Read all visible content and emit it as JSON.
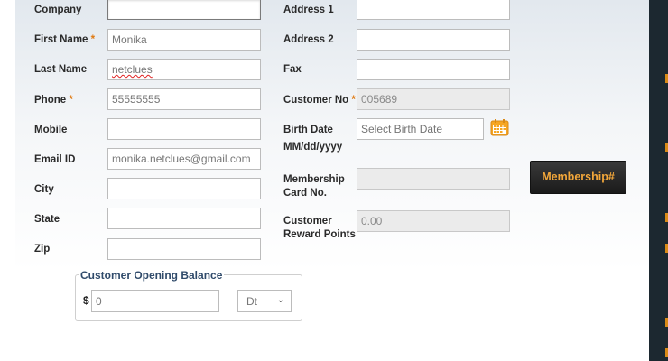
{
  "required_marker": "*",
  "left_fields": {
    "company": {
      "label": "Company",
      "value": ""
    },
    "first_name": {
      "label": "First Name",
      "value": "Monika"
    },
    "last_name": {
      "label": "Last Name",
      "value": "netclues"
    },
    "phone": {
      "label": "Phone",
      "value": "55555555"
    },
    "mobile": {
      "label": "Mobile",
      "value": ""
    },
    "email": {
      "label": "Email ID",
      "value": "monika.netclues@gmail.com"
    },
    "city": {
      "label": "City",
      "value": ""
    },
    "state": {
      "label": "State",
      "value": ""
    },
    "zip": {
      "label": "Zip",
      "value": ""
    }
  },
  "right_fields": {
    "address1": {
      "label": "Address 1",
      "value": ""
    },
    "address2": {
      "label": "Address 2",
      "value": ""
    },
    "fax": {
      "label": "Fax",
      "value": ""
    },
    "customer_no": {
      "label": "Customer No",
      "value": "005689"
    },
    "birth_date": {
      "label": "Birth Date",
      "sublabel": "MM/dd/yyyy",
      "placeholder": "Select Birth Date"
    },
    "membership_card": {
      "label_line1": "Membership",
      "label_line2": "Card No.",
      "value": ""
    },
    "reward_points": {
      "label_line1": "Customer",
      "label_line2": "Reward Points",
      "value": "0.00"
    }
  },
  "membership_button": {
    "label": "Membership#"
  },
  "opening_balance": {
    "legend": "Customer Opening Balance",
    "currency_symbol": "$",
    "amount": "0",
    "type_selected": "Dt"
  },
  "icons": {
    "calendar": "calendar-icon",
    "dropdown": "chevron-down-icon"
  },
  "colors": {
    "accent": "#e07a12",
    "button_text": "#f3a73a",
    "legend": "#2f4a6a"
  }
}
